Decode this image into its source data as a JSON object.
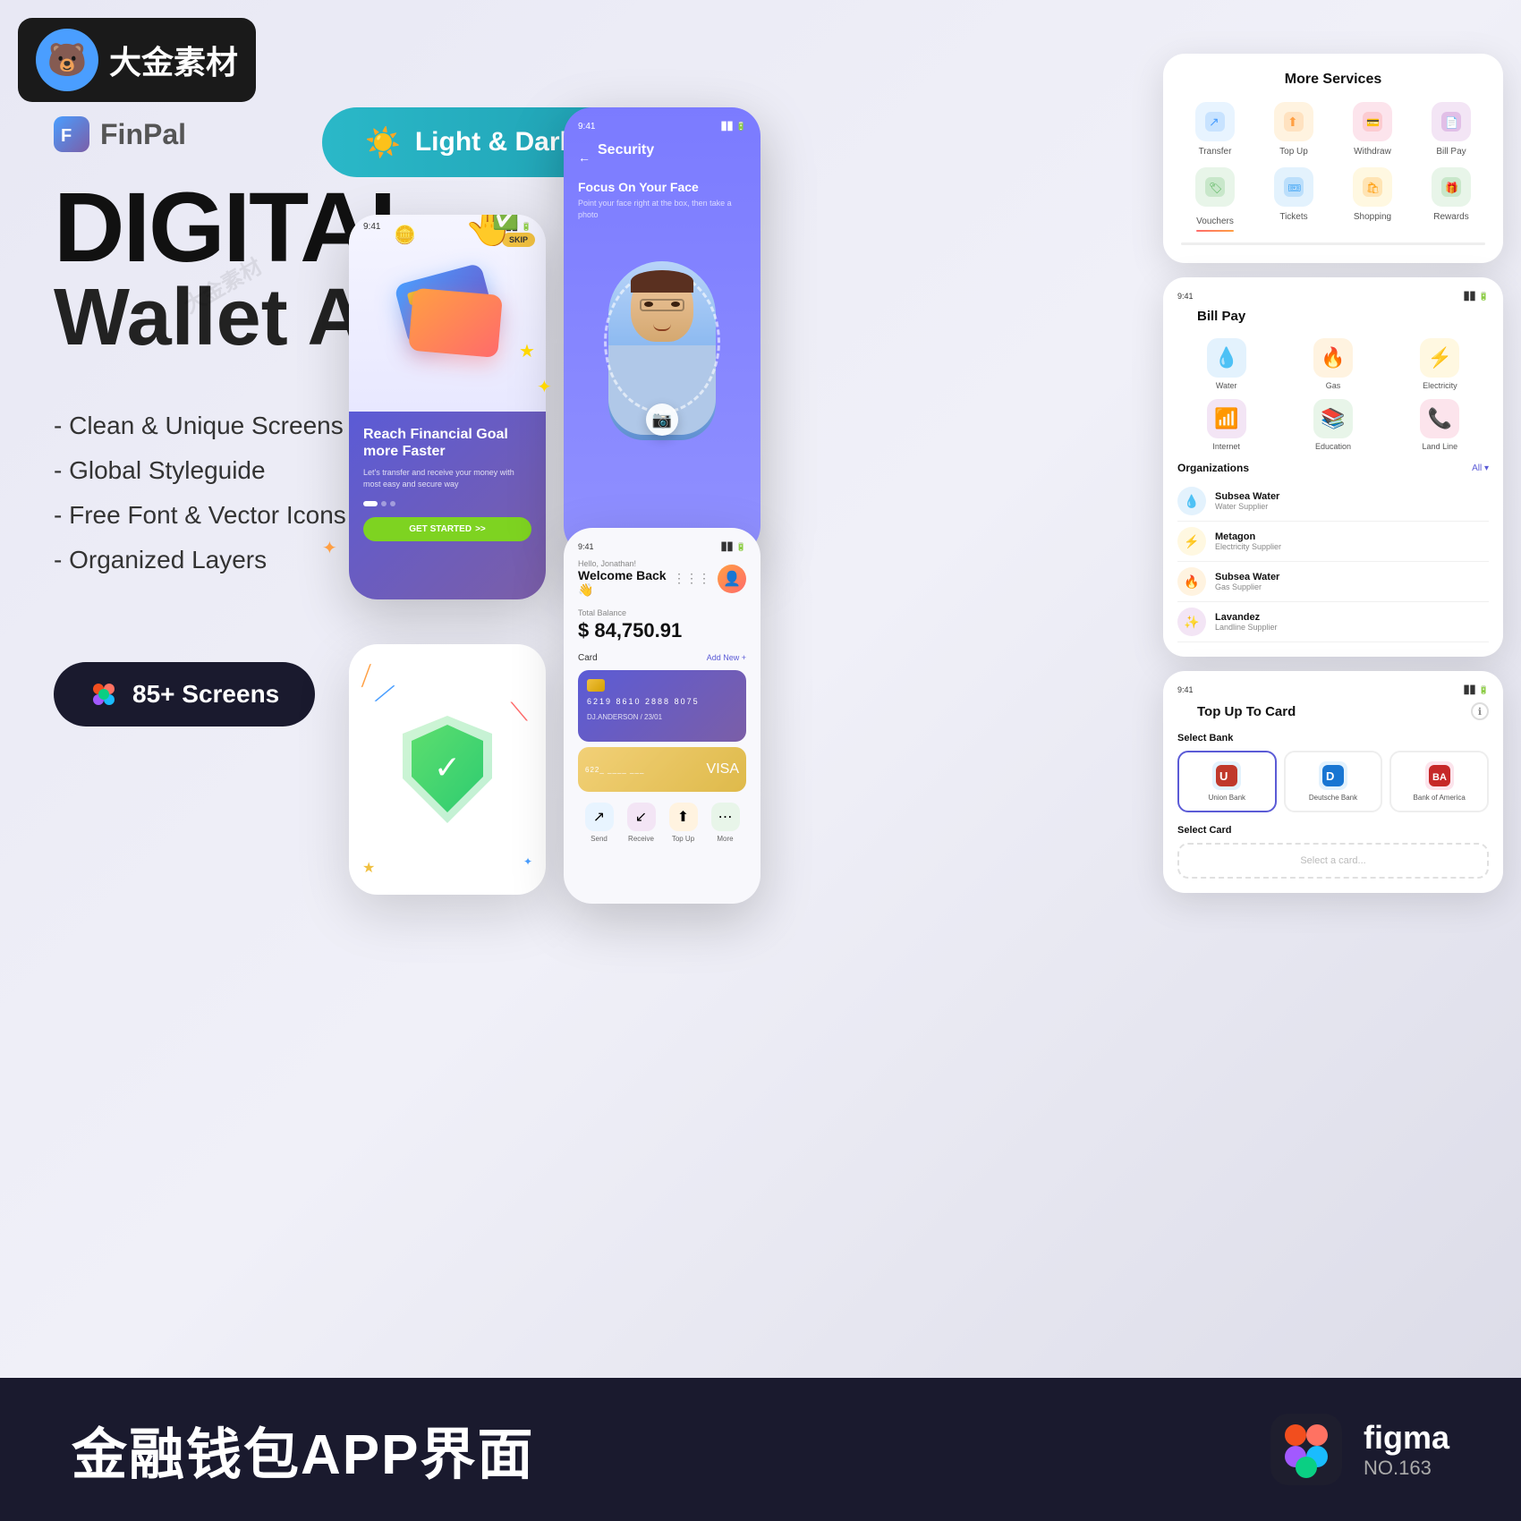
{
  "logo": {
    "badge_text": "大金素材",
    "mascot_emoji": "🐻"
  },
  "brand": {
    "name": "FinPal"
  },
  "mode_badge": {
    "label": "Light & Dark Mode",
    "icon": "☀️"
  },
  "heading": {
    "line1": "DIGITAL",
    "line2": "Wallet App"
  },
  "features": [
    "- Clean & Unique Screens",
    "- Global Styleguide",
    "- Free Font & Vector Icons",
    "- Organized Layers"
  ],
  "screens_badge": {
    "label": "85+ Screens"
  },
  "phone_onboarding": {
    "skip": "SKIP",
    "title": "Reach Financial Goal more Faster",
    "subtitle": "Let's transfer and receive your money with most easy and secure way",
    "btn": "GET STARTED"
  },
  "phone_security": {
    "status_time": "9:41",
    "title": "Security",
    "focus_title": "Focus On Your Face",
    "focus_sub": "Point your face right at the box, then take a photo"
  },
  "phone_dashboard": {
    "status_time": "9:41",
    "greeting": "Hello, Jonathan!",
    "welcome": "Welcome Back 👋",
    "balance_label": "Total Balance",
    "balance": "$ 84,750.91",
    "card_label": "Card",
    "add_new": "Add New +",
    "card_number": "6219  8610  2888  8075",
    "card_holder": "DJ.ANDERSON / 23/01"
  },
  "more_services": {
    "title": "More Services",
    "items": [
      {
        "label": "Transfer",
        "icon": "↗️",
        "color": "#e8f4ff"
      },
      {
        "label": "Top Up",
        "icon": "⬆️",
        "color": "#fff3e0"
      },
      {
        "label": "Withdraw",
        "icon": "🏦",
        "color": "#fce4ec"
      },
      {
        "label": "Bill Pay",
        "icon": "📄",
        "color": "#f3e5f5"
      },
      {
        "label": "Vouchers",
        "icon": "🎫",
        "color": "#e8f5e9"
      },
      {
        "label": "Tickets",
        "icon": "🎟️",
        "color": "#e3f2fd"
      },
      {
        "label": "Shopping",
        "icon": "🛍️",
        "color": "#fff8e1"
      },
      {
        "label": "Rewards",
        "icon": "🎁",
        "color": "#e8f5e9"
      }
    ]
  },
  "bill_pay": {
    "status_time": "9:41",
    "title": "Bill Pay",
    "categories": [
      {
        "label": "Water",
        "icon": "💧",
        "bg": "#e3f2fd"
      },
      {
        "label": "Gas",
        "icon": "🔥",
        "bg": "#fff3e0"
      },
      {
        "label": "Electricity",
        "icon": "⚡",
        "bg": "#fff8e1"
      },
      {
        "label": "Internet",
        "icon": "📶",
        "bg": "#f3e5f5"
      },
      {
        "label": "Education",
        "icon": "📚",
        "bg": "#e8f5e9"
      },
      {
        "label": "Land Line",
        "icon": "📞",
        "bg": "#fce4ec"
      }
    ],
    "organizations_title": "Organizations",
    "filter": "All ▾",
    "orgs": [
      {
        "name": "Subsea Water",
        "type": "Water Supplier",
        "icon": "💧",
        "color": "#e3f2fd"
      },
      {
        "name": "Metagon",
        "type": "Electricity Supplier",
        "icon": "⚡",
        "color": "#fff8e1"
      },
      {
        "name": "Subsea Water",
        "type": "Gas Supplier",
        "icon": "🔥",
        "color": "#fff3e0"
      },
      {
        "name": "Lavandez",
        "type": "Landline Supplier",
        "icon": "✨",
        "color": "#f3e5f5"
      }
    ]
  },
  "top_up_card": {
    "status_time": "9:41",
    "title": "Top Up To Card",
    "select_bank": "Select Bank",
    "select_card": "Select Card",
    "banks": [
      {
        "name": "Union Bank",
        "icon": "🏛️"
      },
      {
        "name": "Deutsche Bank",
        "icon": "🏦"
      },
      {
        "name": "Bank of America",
        "icon": "🇺🇸"
      }
    ]
  },
  "bottom_banner": {
    "text": "金融钱包APP界面",
    "figma_label": "figma",
    "figma_no": "NO.163"
  },
  "colors": {
    "primary": "#5b5bd6",
    "accent_green": "#7ed321",
    "accent_cyan": "#2ab8c8",
    "dark_bg": "#1a1a2e"
  }
}
